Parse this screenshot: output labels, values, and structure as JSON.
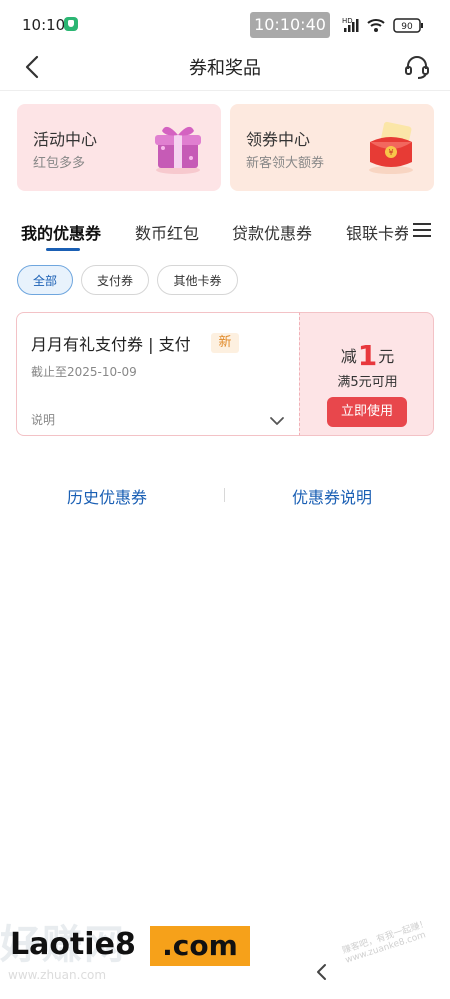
{
  "status_bar": {
    "time": "10:10",
    "clock_overlay": "10:10:40",
    "network": "HD",
    "battery": "90"
  },
  "nav": {
    "title": "券和奖品"
  },
  "cards": [
    {
      "title": "活动中心",
      "subtitle": "红包多多"
    },
    {
      "title": "领券中心",
      "subtitle": "新客领大额券"
    }
  ],
  "tabs": [
    "我的优惠券",
    "数币红包",
    "贷款优惠券",
    "银联卡券"
  ],
  "chips": [
    "全部",
    "支付券",
    "其他卡券"
  ],
  "coupon": {
    "name": "月月有礼支付券 | 支付",
    "badge": "新",
    "expiry": "截止至2025-10-09",
    "desc_label": "说明",
    "discount_prefix": "减",
    "discount_amount": "1",
    "discount_unit": "元",
    "threshold": "满5元可用",
    "action": "立即使用"
  },
  "links": {
    "history": "历史优惠券",
    "explanation": "优惠券说明"
  },
  "watermark": {
    "banner_text": "Laotie8",
    "banner_domain": ".com",
    "left_mark": "好赚网",
    "url": "www.zhuan.com",
    "stamp": "赚客吧，有我一起赚！ www.zuanke8.com"
  },
  "colors": {
    "accent_blue": "#1a5fb4",
    "coupon_red": "#e8474c",
    "activity_card_bg": "#fde4e6",
    "coupon_card_bg": "#fde9df"
  }
}
